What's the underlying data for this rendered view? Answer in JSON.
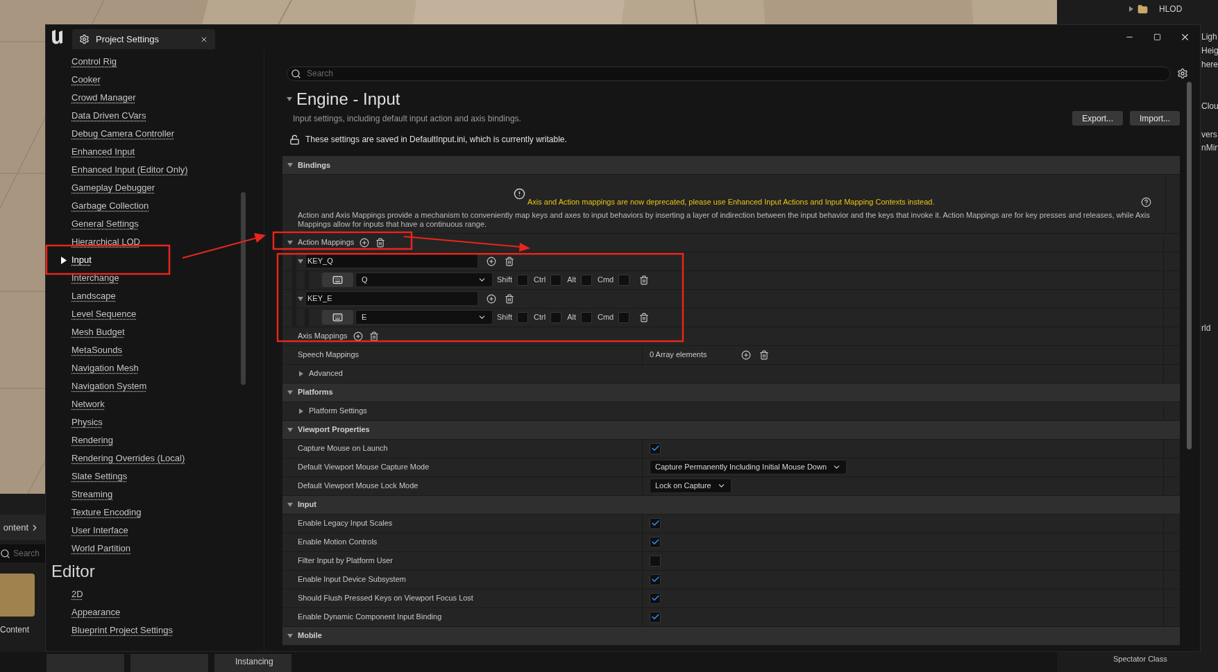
{
  "outliner": {
    "tree_item": {
      "label": "HLOD",
      "expanded": false
    },
    "fragments": [
      "Ligh",
      "Heig",
      "here",
      "Clou",
      "vers",
      "nMin",
      "rld"
    ],
    "footer_label": "Spectator Class"
  },
  "content_browser": {
    "title": "ontent",
    "search_placeholder": "Search",
    "folder_label": "Content"
  },
  "bottom_tabs": [
    "Instancing"
  ],
  "window": {
    "title": "Project Settings"
  },
  "sidebar": {
    "items": [
      {
        "label": "Control Rig",
        "selected": false
      },
      {
        "label": "Cooker",
        "selected": false
      },
      {
        "label": "Crowd Manager",
        "selected": false
      },
      {
        "label": "Data Driven CVars",
        "selected": false
      },
      {
        "label": "Debug Camera Controller",
        "selected": false
      },
      {
        "label": "Enhanced Input",
        "selected": false
      },
      {
        "label": "Enhanced Input (Editor Only)",
        "selected": false
      },
      {
        "label": "Gameplay Debugger",
        "selected": false
      },
      {
        "label": "Garbage Collection",
        "selected": false
      },
      {
        "label": "General Settings",
        "selected": false
      },
      {
        "label": "Hierarchical LOD",
        "selected": false
      },
      {
        "label": "Input",
        "selected": true
      },
      {
        "label": "Interchange",
        "selected": false
      },
      {
        "label": "Landscape",
        "selected": false
      },
      {
        "label": "Level Sequence",
        "selected": false
      },
      {
        "label": "Mesh Budget",
        "selected": false
      },
      {
        "label": "MetaSounds",
        "selected": false
      },
      {
        "label": "Navigation Mesh",
        "selected": false
      },
      {
        "label": "Navigation System",
        "selected": false
      },
      {
        "label": "Network",
        "selected": false
      },
      {
        "label": "Physics",
        "selected": false
      },
      {
        "label": "Rendering",
        "selected": false
      },
      {
        "label": "Rendering Overrides (Local)",
        "selected": false
      },
      {
        "label": "Slate Settings",
        "selected": false
      },
      {
        "label": "Streaming",
        "selected": false
      },
      {
        "label": "Texture Encoding",
        "selected": false
      },
      {
        "label": "User Interface",
        "selected": false
      },
      {
        "label": "World Partition",
        "selected": false
      }
    ],
    "editor_heading": "Editor",
    "editor_items": [
      {
        "label": "2D",
        "selected": false
      },
      {
        "label": "Appearance",
        "selected": false
      },
      {
        "label": "Blueprint Project Settings",
        "selected": false
      }
    ]
  },
  "search": {
    "placeholder": "Search"
  },
  "page": {
    "title": "Engine - Input",
    "expanded": true,
    "description": "Input settings, including default input action and axis bindings.",
    "notice": "These settings are saved in DefaultInput.ini, which is currently writable.",
    "buttons": [
      "Export...",
      "Import..."
    ]
  },
  "sections": [
    {
      "title": "Bindings",
      "expanded": true,
      "rows": [
        {
          "kind": "notice",
          "warning": "Axis and Action mappings are now deprecated, please use Enhanced Input Actions and Input Mapping Contexts instead.",
          "text": "Action and Axis Mappings provide a mechanism to conveniently map keys and axes to input behaviors by inserting a layer of indirection between the input behavior and the keys that invoke it. Action Mappings are for key presses and releases, while Axis Mappings allow for inputs that have a continuous range."
        },
        {
          "kind": "array",
          "label": "Action Mappings",
          "expanded": true,
          "items": [
            {
              "name": "KEY_Q",
              "expanded": true,
              "keys": [
                {
                  "key": "Q",
                  "modifiers": [
                    {
                      "label": "Shift",
                      "checked": false
                    },
                    {
                      "label": "Ctrl",
                      "checked": false
                    },
                    {
                      "label": "Alt",
                      "checked": false
                    },
                    {
                      "label": "Cmd",
                      "checked": false
                    }
                  ]
                }
              ]
            },
            {
              "name": "KEY_E",
              "expanded": true,
              "keys": [
                {
                  "key": "E",
                  "modifiers": [
                    {
                      "label": "Shift",
                      "checked": false
                    },
                    {
                      "label": "Ctrl",
                      "checked": false
                    },
                    {
                      "label": "Alt",
                      "checked": false
                    },
                    {
                      "label": "Cmd",
                      "checked": false
                    }
                  ]
                }
              ]
            }
          ]
        },
        {
          "kind": "empty_array",
          "label": "Axis Mappings"
        },
        {
          "kind": "array_count",
          "label": "Speech Mappings",
          "value": "0 Array elements"
        },
        {
          "kind": "category",
          "label": "Advanced",
          "expanded": false
        }
      ]
    },
    {
      "title": "Platforms",
      "expanded": true,
      "rows": [
        {
          "kind": "category",
          "label": "Platform Settings",
          "expanded": false
        }
      ]
    },
    {
      "title": "Viewport Properties",
      "expanded": true,
      "rows": [
        {
          "kind": "checkbox",
          "label": "Capture Mouse on Launch",
          "checked": true
        },
        {
          "kind": "dropdown",
          "label": "Default Viewport Mouse Capture Mode",
          "value": "Capture Permanently Including Initial Mouse Down"
        },
        {
          "kind": "dropdown",
          "label": "Default Viewport Mouse Lock Mode",
          "value": "Lock on Capture"
        }
      ]
    },
    {
      "title": "Input",
      "expanded": true,
      "rows": [
        {
          "kind": "checkbox",
          "label": "Enable Legacy Input Scales",
          "checked": true
        },
        {
          "kind": "checkbox",
          "label": "Enable Motion Controls",
          "checked": true
        },
        {
          "kind": "checkbox",
          "label": "Filter Input by Platform User",
          "checked": false
        },
        {
          "kind": "checkbox",
          "label": "Enable Input Device Subsystem",
          "checked": true
        },
        {
          "kind": "checkbox",
          "label": "Should Flush Pressed Keys on Viewport Focus Lost",
          "checked": true
        },
        {
          "kind": "checkbox",
          "label": "Enable Dynamic Component Input Binding",
          "checked": true
        }
      ]
    },
    {
      "title": "Mobile",
      "expanded": true
    }
  ]
}
